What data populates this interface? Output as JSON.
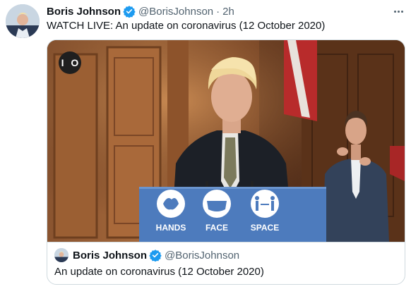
{
  "tweet": {
    "display_name": "Boris Johnson",
    "handle": "@BorisJohnson",
    "separator": "·",
    "time": "2h",
    "text": "WATCH LIVE: An update on coronavirus (12 October 2020)",
    "verified_icon": "verified-badge-icon",
    "more_icon": "more-options-icon"
  },
  "media": {
    "badge_text": "I O",
    "podium": {
      "labels": [
        "HANDS",
        "FACE",
        "SPACE"
      ]
    }
  },
  "quote": {
    "display_name": "Boris Johnson",
    "handle": "@BorisJohnson",
    "text": "An update on coronavirus (12 October 2020)"
  },
  "colors": {
    "verified_blue": "#1d9bf0",
    "podium_blue": "#4d7bbd",
    "secondary_text": "#536471",
    "border": "#cfd9de"
  }
}
